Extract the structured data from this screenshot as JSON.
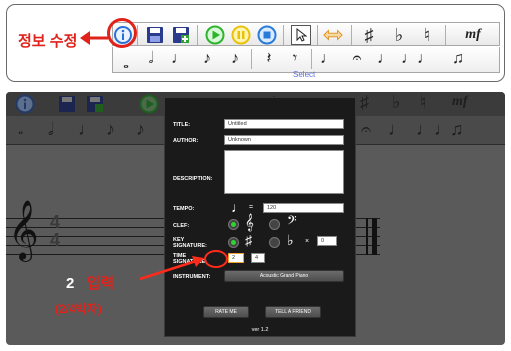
{
  "callout": {
    "label": "정보 수정"
  },
  "toolbar": {
    "row1_icons": [
      "info-icon",
      "save-icon",
      "save-as-icon",
      "play-icon",
      "pause-icon",
      "stop-icon",
      "select-cursor-icon",
      "move-arrows-icon",
      "sharp-icon",
      "flat-icon",
      "natural-icon",
      "dynamic-mf-icon"
    ],
    "dynamic_mark": "mf",
    "row2_icons": [
      "whole-note-icon",
      "half-note-icon",
      "quarter-note-icon",
      "eighth-note-icon",
      "sixteenth-note-icon",
      "quarter-rest-icon",
      "eighth-rest-icon",
      "dotted-quarter-icon",
      "fermata-note-icon",
      "accent-note-icon",
      "tie-notes-icon",
      "beamed-notes-icon"
    ],
    "select_label": "Select"
  },
  "dialog": {
    "title_label": "TITLE:",
    "title_value": "Untitled",
    "author_label": "AUTHOR:",
    "author_value": "Unknown",
    "description_label": "DESCRIPTION:",
    "description_value": "",
    "tempo_label": "TEMPO:",
    "tempo_equals": "=",
    "tempo_value": "120",
    "clef_label": "CLEF:",
    "key_label_1": "KEY",
    "key_label_2": "SIGNATURE:",
    "key_times": "×",
    "key_count": "0",
    "time_label_1": "TIME",
    "time_label_2": "SIGNATURE:",
    "time_numerator": "2",
    "time_denominator": "4",
    "instrument_label": "INSTRUMENT:",
    "instrument_value": "Acoustic Grand Piano",
    "rate_button": "RATE ME",
    "tell_button": "TELL A FRIEND",
    "version": "ver 1.2"
  },
  "staff": {
    "time_signature_top": "4",
    "time_signature_bottom": "4"
  },
  "annotation": {
    "number": "2",
    "action": "입력",
    "note": "(2/4박자)",
    "color": "#e0221a"
  }
}
